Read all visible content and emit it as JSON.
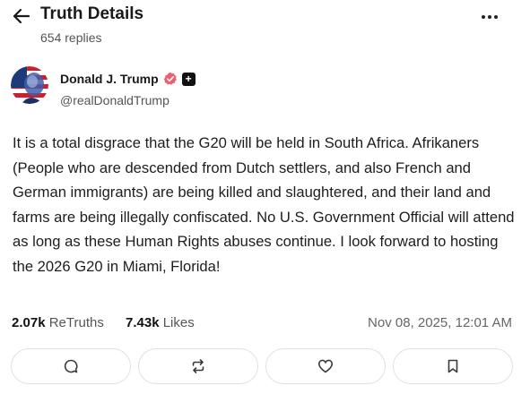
{
  "header": {
    "title": "Truth Details",
    "subtitle": "654 replies",
    "back_icon": "arrow-left-icon",
    "more_icon": "more-horizontal-icon"
  },
  "author": {
    "name": "Donald J. Trump",
    "handle": "@realDonaldTrump",
    "verified_icon": "verified-badge-icon",
    "verified_color": "#f25c6c",
    "plus_badge": "+"
  },
  "post": {
    "text": "It is a total disgrace that the G20 will be held in South Africa. Afrikaners (People who are descended from Dutch settlers, and also French and German immigrants) are being killed and slaughtered, and their land and farms are being illegally confiscated. No U.S. Government Official will attend as long as these Human Rights abuses continue. I look forward to hosting the 2026 G20 in Miami, Florida!"
  },
  "stats": {
    "retruths_count": "2.07k",
    "retruths_label": "ReTruths",
    "likes_count": "7.43k",
    "likes_label": "Likes",
    "timestamp": "Nov 08, 2025, 12:01 AM"
  },
  "actions": {
    "reply_icon": "comment-icon",
    "retruth_icon": "repost-icon",
    "like_icon": "heart-icon",
    "bookmark_icon": "bookmark-icon"
  }
}
